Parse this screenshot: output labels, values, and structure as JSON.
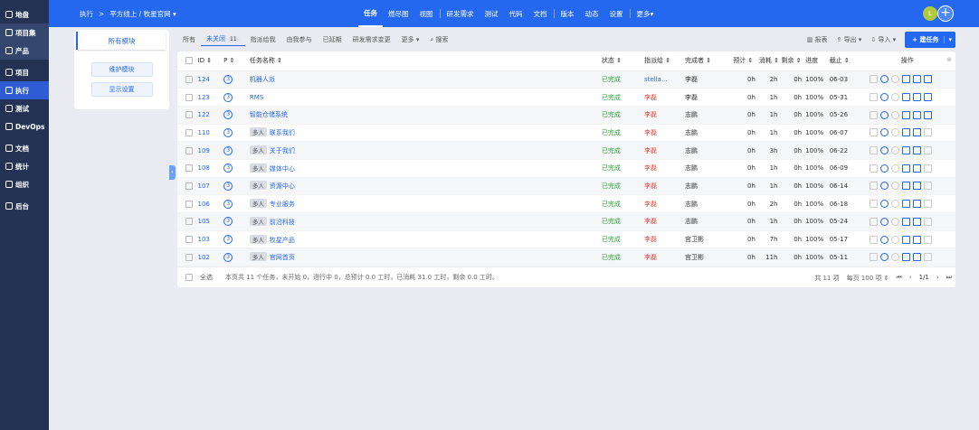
{
  "sidebar": {
    "items": [
      {
        "label": "地盘",
        "icon": "home-icon"
      },
      {
        "label": "项目集",
        "icon": "grid-icon"
      },
      {
        "label": "产品",
        "icon": "product-icon"
      },
      {
        "label": "项目",
        "icon": "project-icon"
      },
      {
        "label": "执行",
        "icon": "execution-icon"
      },
      {
        "label": "测试",
        "icon": "test-icon"
      },
      {
        "label": "DevOps",
        "icon": "devops-icon"
      },
      {
        "label": "文档",
        "icon": "doc-icon"
      },
      {
        "label": "统计",
        "icon": "chart-icon"
      },
      {
        "label": "组织",
        "icon": "org-icon"
      },
      {
        "label": "后台",
        "icon": "gear-icon"
      }
    ]
  },
  "header": {
    "crumb_root": "执行",
    "crumb_sep": ">",
    "crumb_project": "平方线上 / 牧星官网",
    "nav": [
      "任务",
      "燃尽图",
      "视图",
      "研发需求",
      "测试",
      "代码",
      "文档",
      "版本",
      "动态",
      "设置",
      "更多"
    ],
    "avatar": "L"
  },
  "left_panel": {
    "tab": "所有模块",
    "btn1": "维护模块",
    "btn2": "显示设置"
  },
  "toolbar": {
    "filters": [
      "所有",
      "未关闭",
      "指派给我",
      "由我参与",
      "已延期",
      "研发需求变更",
      "更多"
    ],
    "unclosed_count": "11",
    "search": "搜索",
    "report": "报表",
    "export": "导出",
    "import": "导入",
    "create": "建任务"
  },
  "table": {
    "headers": {
      "id": "ID",
      "pri": "P",
      "name": "任务名称",
      "status": "状态",
      "assignee": "指派给",
      "finisher": "完成者",
      "estimate": "预计",
      "consumed": "消耗",
      "left": "剩余",
      "progress": "进度",
      "deadline": "截止",
      "actions": "操作"
    },
    "rows": [
      {
        "id": "124",
        "pri": "3",
        "multi": "",
        "name": "机器人派",
        "status": "已完成",
        "assignee": "stella...",
        "finisher": "李磊",
        "estimate": "0h",
        "consumed": "2h",
        "left": "0h",
        "progress": "100%",
        "deadline": "06-03"
      },
      {
        "id": "123",
        "pri": "3",
        "multi": "",
        "name": "RMS",
        "status": "已完成",
        "assignee": "李磊",
        "finisher": "李磊",
        "estimate": "0h",
        "consumed": "1h",
        "left": "0h",
        "progress": "100%",
        "deadline": "05-31"
      },
      {
        "id": "122",
        "pri": "3",
        "multi": "",
        "name": "智能仓储系统",
        "status": "已完成",
        "assignee": "李磊",
        "finisher": "志鹏",
        "estimate": "0h",
        "consumed": "1h",
        "left": "0h",
        "progress": "100%",
        "deadline": "05-26"
      },
      {
        "id": "110",
        "pri": "3",
        "multi": "多人",
        "name": "联系我们",
        "status": "已完成",
        "assignee": "李磊",
        "finisher": "志鹏",
        "estimate": "0h",
        "consumed": "1h",
        "left": "0h",
        "progress": "100%",
        "deadline": "06-07"
      },
      {
        "id": "109",
        "pri": "3",
        "multi": "多人",
        "name": "关于我们",
        "status": "已完成",
        "assignee": "李磊",
        "finisher": "志鹏",
        "estimate": "0h",
        "consumed": "3h",
        "left": "0h",
        "progress": "100%",
        "deadline": "06-22"
      },
      {
        "id": "108",
        "pri": "3",
        "multi": "多人",
        "name": "媒体中心",
        "status": "已完成",
        "assignee": "李磊",
        "finisher": "志鹏",
        "estimate": "0h",
        "consumed": "1h",
        "left": "0h",
        "progress": "100%",
        "deadline": "06-09"
      },
      {
        "id": "107",
        "pri": "3",
        "multi": "多人",
        "name": "资源中心",
        "status": "已完成",
        "assignee": "李磊",
        "finisher": "志鹏",
        "estimate": "0h",
        "consumed": "1h",
        "left": "0h",
        "progress": "100%",
        "deadline": "06-14"
      },
      {
        "id": "106",
        "pri": "3",
        "multi": "多人",
        "name": "专业服务",
        "status": "已完成",
        "assignee": "李磊",
        "finisher": "志鹏",
        "estimate": "0h",
        "consumed": "2h",
        "left": "0h",
        "progress": "100%",
        "deadline": "06-18"
      },
      {
        "id": "105",
        "pri": "3",
        "multi": "多人",
        "name": "前沿科技",
        "status": "已完成",
        "assignee": "李磊",
        "finisher": "志鹏",
        "estimate": "0h",
        "consumed": "1h",
        "left": "0h",
        "progress": "100%",
        "deadline": "05-24"
      },
      {
        "id": "103",
        "pri": "3",
        "multi": "多人",
        "name": "牧星产品",
        "status": "已完成",
        "assignee": "李磊",
        "finisher": "宫卫彬",
        "estimate": "0h",
        "consumed": "7h",
        "left": "0h",
        "progress": "100%",
        "deadline": "05-17"
      },
      {
        "id": "102",
        "pri": "3",
        "multi": "多人",
        "name": "官网首页",
        "status": "已完成",
        "assignee": "李磊",
        "finisher": "宫卫彬",
        "estimate": "0h",
        "consumed": "11h",
        "left": "0h",
        "progress": "100%",
        "deadline": "05-11"
      }
    ]
  },
  "footer": {
    "select_all": "全选",
    "summary": "本页共 11 个任务，未开始 0，进行中 0，总预计 0.0 工时，已消耗 31.0 工时，剩余 0.0 工时。",
    "total": "共 11 项",
    "per_page": "每页 100 项",
    "page": "1/1"
  }
}
